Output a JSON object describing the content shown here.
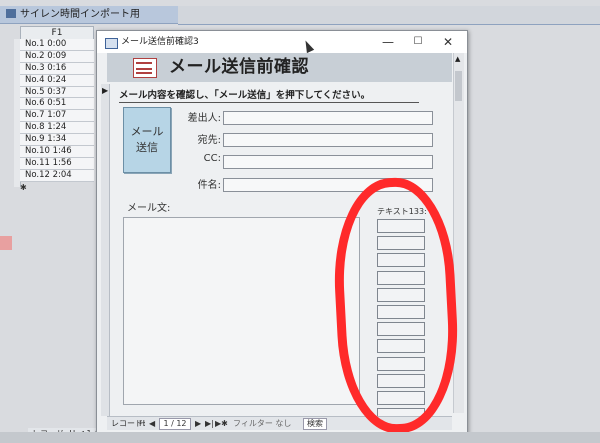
{
  "background_window": {
    "tab_title": "サイレン時間インポート用",
    "column_header": "F1",
    "rows": [
      "No.1  0:00",
      "No.2  0:09",
      "No.3  0:16",
      "No.4  0:24",
      "No.5  0:37",
      "No.6  0:51",
      "No.7  1:07",
      "No.8  1:24",
      "No.9  1:34",
      "No.10  1:46",
      "No.11  1:56",
      "No.12  2:04"
    ],
    "new_record_mark": "✱",
    "record_nav": "レコード: H  ◀  1 / 12    ▶  ▶|  ▶✱   フィルター なし   検索"
  },
  "dialog": {
    "window_title": "メール送信前確認3",
    "minimize": "—",
    "maximize": "☐",
    "close": "✕",
    "header_title": "メール送信前確認",
    "instruction": "メール内容を確認し、「メール送信」を押下してください。",
    "send_button_line1": "メール",
    "send_button_line2": "送信",
    "fields": {
      "sender_label": "差出人:",
      "to_label": "宛先:",
      "cc_label": "CC:",
      "subject_label": "件名:"
    },
    "body_label": "メール文:",
    "textbox133_label": "テキスト133:",
    "textbox133_rows": 12,
    "record_selector_arrow": "▶",
    "record_nav": {
      "label": "レコード:",
      "first": "H",
      "prev": "◀",
      "current": "1 / 12",
      "next": "▶",
      "last": "▶|",
      "new": "▶✱",
      "filter": "フィルター なし",
      "search": "検索"
    }
  },
  "annotation": {
    "circle_color": "#ff2a2a"
  }
}
